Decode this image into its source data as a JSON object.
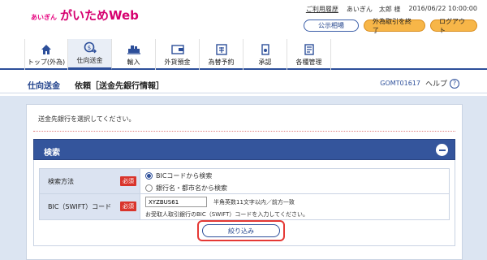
{
  "header": {
    "logo_small": "あいぎん",
    "logo_big": "がいためWeb",
    "usage_history": "ご利用履歴",
    "user_name": "あいぎん　太郎 様",
    "datetime": "2016/06/22 10:00:00",
    "btn_rates": "公示相場",
    "btn_end_fx": "外為取引を終了",
    "btn_logout": "ログアウト"
  },
  "nav": {
    "items": [
      {
        "label": "トップ(外為)",
        "icon": "home-icon"
      },
      {
        "label": "仕向送金",
        "icon": "remittance-icon"
      },
      {
        "label": "輸入",
        "icon": "import-icon"
      },
      {
        "label": "外貨預金",
        "icon": "deposit-icon"
      },
      {
        "label": "為替予約",
        "icon": "fx-contract-icon"
      },
      {
        "label": "承認",
        "icon": "approval-icon"
      },
      {
        "label": "各種管理",
        "icon": "management-icon"
      }
    ]
  },
  "page": {
    "section": "仕向送金",
    "title": "依頼［送金先銀行情報］",
    "code": "GOMT01617",
    "help": "ヘルプ"
  },
  "main": {
    "instruction": "送金先銀行を選択してください。",
    "search_title": "検索",
    "method_label": "検索方法",
    "required": "必須",
    "method_opt1": "BICコードから検索",
    "method_opt2": "銀行名・都市名から検索",
    "bic_label": "BIC（SWIFT）コード",
    "bic_value": "XYZBUS61",
    "bic_hint": "半角英数11文字以内／前方一致",
    "bic_desc": "お受取人取引銀行のBIC（SWIFT）コードを入力してください。",
    "narrow_button": "絞り込み"
  },
  "colors": {
    "brand": "#d6006f",
    "navy": "#2d4f9a",
    "required": "#d9342b",
    "highlight": "#e53935"
  }
}
